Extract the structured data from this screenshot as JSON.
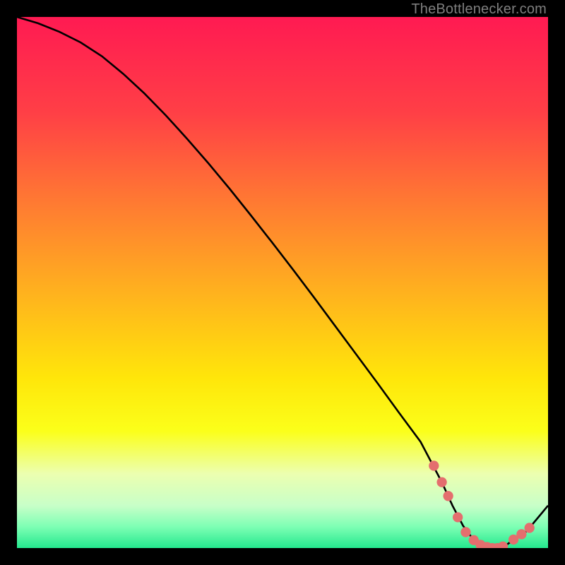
{
  "attribution": "TheBottlenecker.com",
  "chart_data": {
    "type": "line",
    "title": "",
    "xlabel": "",
    "ylabel": "",
    "xlim": [
      0,
      100
    ],
    "ylim": [
      0,
      100
    ],
    "series": [
      {
        "name": "curve",
        "x": [
          0,
          4,
          8,
          12,
          16,
          20,
          24,
          28,
          32,
          36,
          40,
          44,
          48,
          52,
          56,
          60,
          64,
          68,
          72,
          76,
          80,
          82,
          84,
          86,
          88,
          90,
          92,
          96,
          100
        ],
        "y": [
          100,
          98.8,
          97.2,
          95.2,
          92.6,
          89.3,
          85.6,
          81.5,
          77.1,
          72.5,
          67.7,
          62.7,
          57.6,
          52.4,
          47.1,
          41.7,
          36.3,
          30.9,
          25.4,
          20.0,
          12.4,
          8.0,
          4.2,
          1.5,
          0.2,
          0.0,
          0.5,
          3.2,
          8.0
        ]
      }
    ],
    "markers": {
      "comment": "salmon dotted segment around the valley",
      "color": "#e46e6e",
      "x": [
        78.5,
        80,
        81.2,
        83,
        84.5,
        86,
        87.3,
        88.5,
        89.5,
        90.5,
        91.5,
        93.5,
        95,
        96.5
      ],
      "y": [
        15.5,
        12.4,
        9.8,
        5.8,
        3.0,
        1.5,
        0.6,
        0.2,
        0.0,
        0.0,
        0.3,
        1.6,
        2.6,
        3.8
      ]
    },
    "background_gradient": {
      "stops": [
        {
          "offset": 0.0,
          "color": "#ff1a52"
        },
        {
          "offset": 0.18,
          "color": "#ff3f46"
        },
        {
          "offset": 0.35,
          "color": "#ff7a32"
        },
        {
          "offset": 0.52,
          "color": "#ffb21e"
        },
        {
          "offset": 0.68,
          "color": "#ffe60a"
        },
        {
          "offset": 0.78,
          "color": "#fbff1a"
        },
        {
          "offset": 0.86,
          "color": "#ecffb0"
        },
        {
          "offset": 0.92,
          "color": "#c8ffc8"
        },
        {
          "offset": 0.96,
          "color": "#7dffb4"
        },
        {
          "offset": 1.0,
          "color": "#24e88e"
        }
      ]
    }
  }
}
